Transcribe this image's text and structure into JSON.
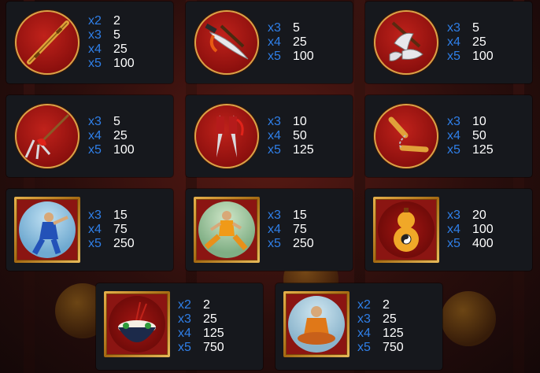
{
  "colors": {
    "card_bg": "#16181d",
    "multiplier": "#2f7fe8",
    "value": "#ffffff",
    "medallion_red": "#c0221b",
    "gold_frame": "#e6b04a"
  },
  "symbols": [
    {
      "name": "staff",
      "icon": "bamboo-staff-icon",
      "pays": [
        {
          "m": "x2",
          "v": "2"
        },
        {
          "m": "x3",
          "v": "5"
        },
        {
          "m": "x4",
          "v": "25"
        },
        {
          "m": "x5",
          "v": "100"
        }
      ]
    },
    {
      "name": "broadsword",
      "icon": "broadsword-icon",
      "pays": [
        {
          "m": "x3",
          "v": "5"
        },
        {
          "m": "x4",
          "v": "25"
        },
        {
          "m": "x5",
          "v": "100"
        }
      ]
    },
    {
      "name": "crescent-blades",
      "icon": "crescent-blades-icon",
      "pays": [
        {
          "m": "x3",
          "v": "5"
        },
        {
          "m": "x4",
          "v": "25"
        },
        {
          "m": "x5",
          "v": "100"
        }
      ]
    },
    {
      "name": "trident-spear",
      "icon": "trident-spear-icon",
      "pays": [
        {
          "m": "x3",
          "v": "5"
        },
        {
          "m": "x4",
          "v": "25"
        },
        {
          "m": "x5",
          "v": "100"
        }
      ]
    },
    {
      "name": "twin-daggers",
      "icon": "twin-daggers-icon",
      "pays": [
        {
          "m": "x3",
          "v": "10"
        },
        {
          "m": "x4",
          "v": "50"
        },
        {
          "m": "x5",
          "v": "125"
        }
      ]
    },
    {
      "name": "nunchaku",
      "icon": "nunchaku-icon",
      "pays": [
        {
          "m": "x3",
          "v": "10"
        },
        {
          "m": "x4",
          "v": "50"
        },
        {
          "m": "x5",
          "v": "125"
        }
      ]
    },
    {
      "name": "blue-fighter",
      "icon": "blue-fighter-icon",
      "pays": [
        {
          "m": "x3",
          "v": "15"
        },
        {
          "m": "x4",
          "v": "75"
        },
        {
          "m": "x5",
          "v": "250"
        }
      ]
    },
    {
      "name": "orange-monk-fighter",
      "icon": "orange-monk-fighter-icon",
      "pays": [
        {
          "m": "x3",
          "v": "15"
        },
        {
          "m": "x4",
          "v": "75"
        },
        {
          "m": "x5",
          "v": "250"
        }
      ]
    },
    {
      "name": "gourd",
      "icon": "gourd-icon",
      "pays": [
        {
          "m": "x3",
          "v": "20"
        },
        {
          "m": "x4",
          "v": "100"
        },
        {
          "m": "x5",
          "v": "400"
        }
      ]
    },
    {
      "name": "rice-bowl",
      "icon": "rice-bowl-icon",
      "pays": [
        {
          "m": "x2",
          "v": "2"
        },
        {
          "m": "x3",
          "v": "25"
        },
        {
          "m": "x4",
          "v": "125"
        },
        {
          "m": "x5",
          "v": "750"
        }
      ]
    },
    {
      "name": "meditating-monk",
      "icon": "meditating-monk-icon",
      "pays": [
        {
          "m": "x2",
          "v": "2"
        },
        {
          "m": "x3",
          "v": "25"
        },
        {
          "m": "x4",
          "v": "125"
        },
        {
          "m": "x5",
          "v": "750"
        }
      ]
    }
  ]
}
